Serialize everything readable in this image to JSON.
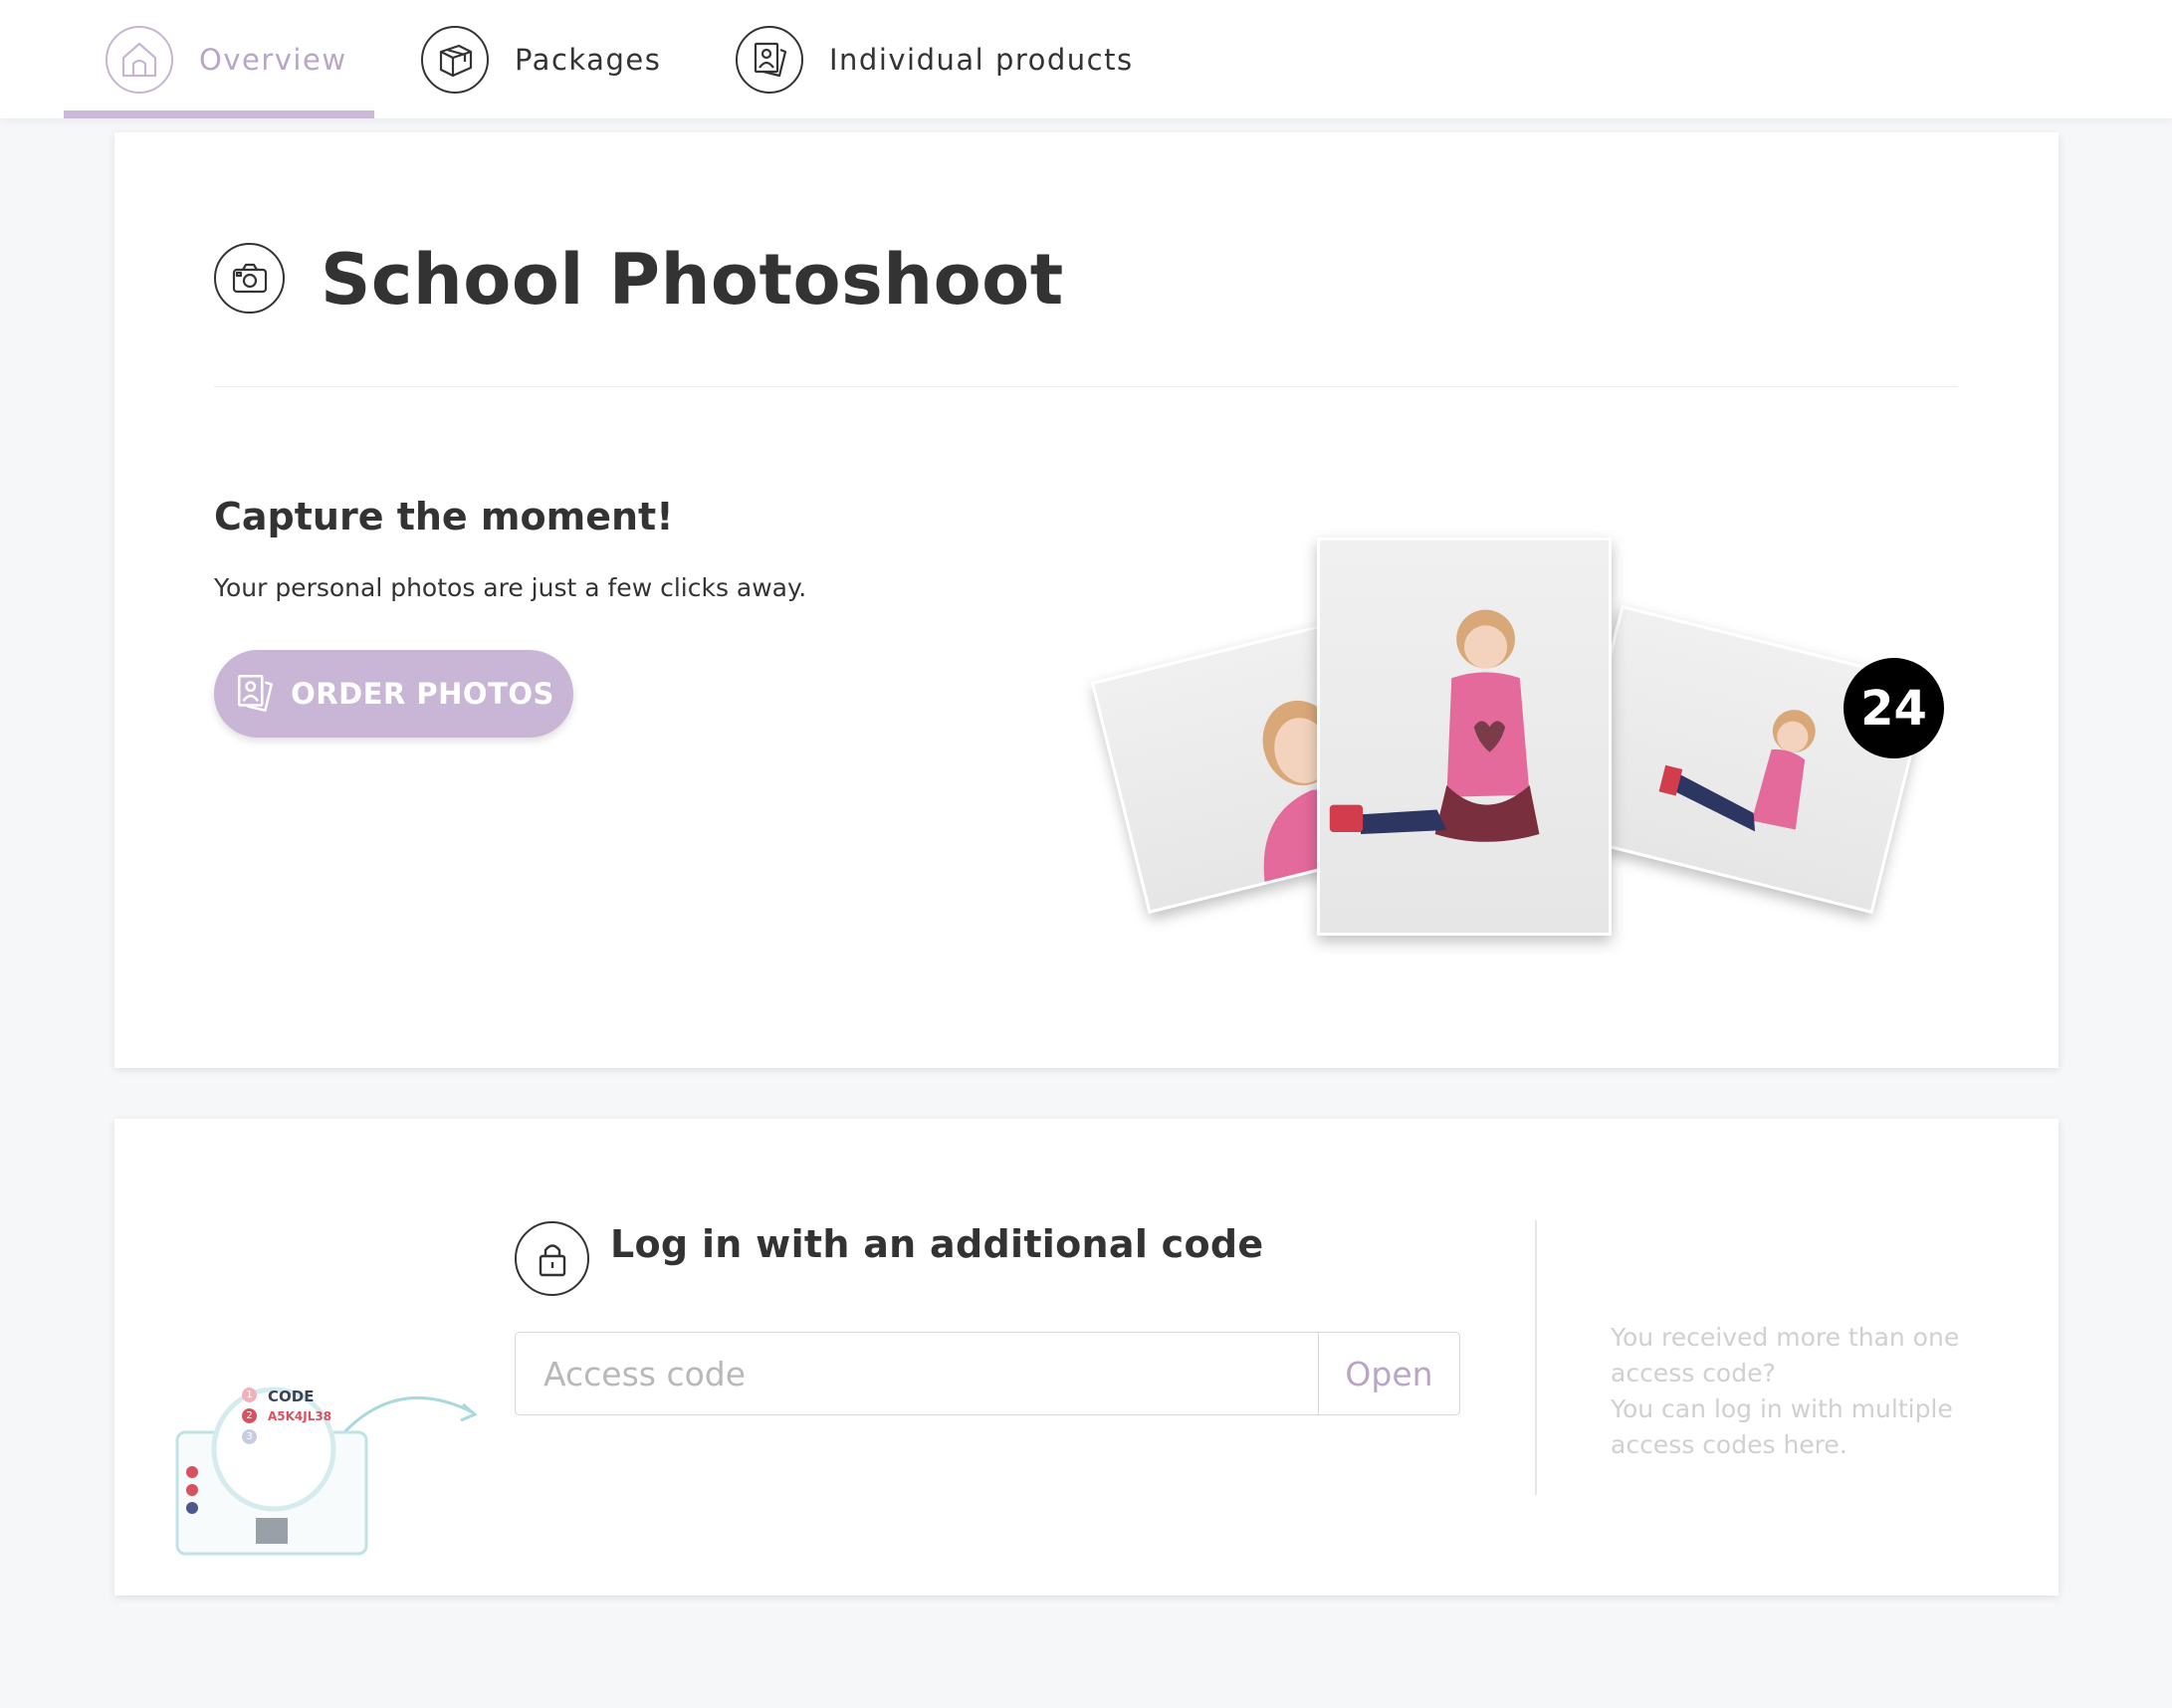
{
  "nav": {
    "tabs": [
      {
        "label": "Overview",
        "icon": "home-icon",
        "active": true
      },
      {
        "label": "Packages",
        "icon": "box-icon",
        "active": false
      },
      {
        "label": "Individual products",
        "icon": "portrait-photos-icon",
        "active": false
      }
    ]
  },
  "hero": {
    "title": "School Photoshoot",
    "title_icon": "camera-icon",
    "heading": "Capture the moment!",
    "subtext": "Your personal photos are just a few clicks away.",
    "order_button": "ORDER PHOTOS",
    "photo_count": "24"
  },
  "login": {
    "heading": "Log in with an additional code",
    "icon": "lock-icon",
    "placeholder": "Access code",
    "open_button": "Open",
    "help_line1": "You received more than one access code?",
    "help_line2": "You can log in with multiple access codes here."
  },
  "coupon": {
    "label": "CODE",
    "sample_code": "A5K4JL38",
    "steps": [
      "1",
      "2",
      "3"
    ]
  },
  "colors": {
    "accent": "#c9b6d6",
    "accent_text": "#b9a6c6",
    "background": "#f6f7f9",
    "text": "#333333"
  }
}
